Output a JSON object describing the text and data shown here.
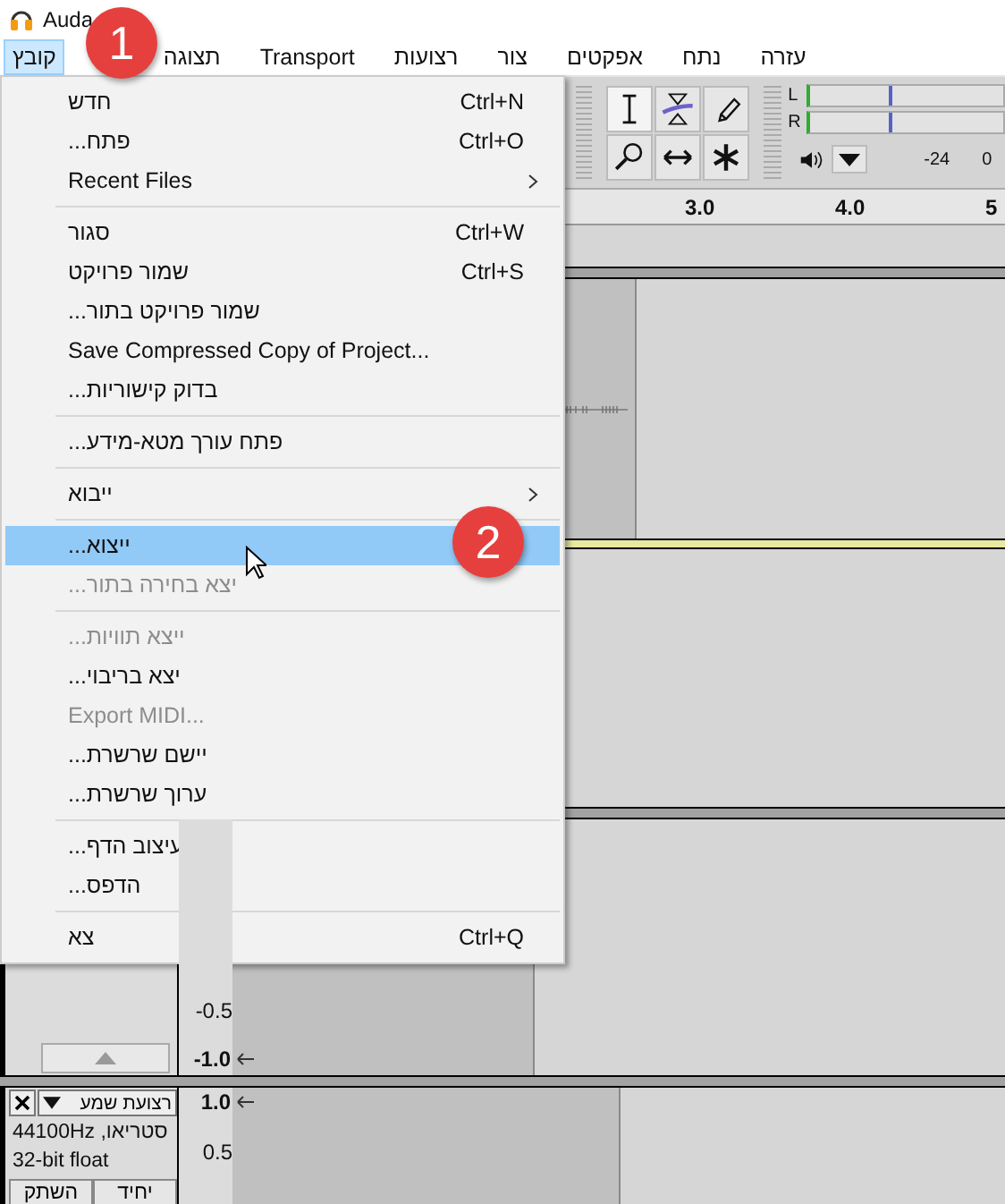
{
  "window": {
    "title": "Auda"
  },
  "menubar": [
    {
      "label": "עזרה",
      "selected": false
    },
    {
      "label": "נתח",
      "selected": false
    },
    {
      "label": "אפקטים",
      "selected": false
    },
    {
      "label": "צור",
      "selected": false
    },
    {
      "label": "רצועות",
      "selected": false
    },
    {
      "label": "Transport",
      "selected": false
    },
    {
      "label": "תצוגה",
      "selected": false
    },
    {
      "label": "קובץ",
      "selected": true
    }
  ],
  "file_menu": [
    {
      "kind": "item",
      "label": "חדש",
      "shortcut": "Ctrl+N",
      "submenu": false,
      "disabled": false,
      "selected": false
    },
    {
      "kind": "item",
      "label": "פתח...",
      "shortcut": "Ctrl+O",
      "submenu": false,
      "disabled": false,
      "selected": false
    },
    {
      "kind": "item",
      "label": "Recent Files",
      "submenu": true,
      "disabled": false,
      "selected": false
    },
    {
      "kind": "separator"
    },
    {
      "kind": "item",
      "label": "סגור",
      "shortcut": "Ctrl+W",
      "submenu": false,
      "disabled": false,
      "selected": false
    },
    {
      "kind": "item",
      "label": "שמור פרויקט",
      "shortcut": "Ctrl+S",
      "submenu": false,
      "disabled": false,
      "selected": false
    },
    {
      "kind": "item",
      "label": "שמור פרויקט בתור...",
      "submenu": false,
      "disabled": false,
      "selected": false
    },
    {
      "kind": "item",
      "label": "Save Compressed Copy of Project...",
      "submenu": false,
      "disabled": false,
      "selected": false
    },
    {
      "kind": "item",
      "label": "בדוק קישוריות...",
      "submenu": false,
      "disabled": false,
      "selected": false
    },
    {
      "kind": "separator"
    },
    {
      "kind": "item",
      "label": "פתח עורך מטא-מידע...",
      "submenu": false,
      "disabled": false,
      "selected": false
    },
    {
      "kind": "separator"
    },
    {
      "kind": "item",
      "label": "ייבוא",
      "submenu": true,
      "disabled": false,
      "selected": false
    },
    {
      "kind": "separator"
    },
    {
      "kind": "item",
      "label": "ייצוא...",
      "submenu": false,
      "disabled": false,
      "selected": true
    },
    {
      "kind": "item",
      "label": "יצא בחירה בתור...",
      "submenu": false,
      "disabled": true,
      "selected": false
    },
    {
      "kind": "separator"
    },
    {
      "kind": "item",
      "label": "ייצא תוויות...",
      "submenu": false,
      "disabled": true,
      "selected": false
    },
    {
      "kind": "item",
      "label": "יצא בריבוי...",
      "submenu": false,
      "disabled": false,
      "selected": false
    },
    {
      "kind": "item",
      "label": "Export MIDI...",
      "submenu": false,
      "disabled": true,
      "selected": false
    },
    {
      "kind": "item",
      "label": "יישם שרשרת...",
      "submenu": false,
      "disabled": false,
      "selected": false
    },
    {
      "kind": "item",
      "label": "ערוך שרשרת...",
      "submenu": false,
      "disabled": false,
      "selected": false
    },
    {
      "kind": "separator"
    },
    {
      "kind": "item",
      "label": "עיצוב הדף...",
      "submenu": false,
      "disabled": false,
      "selected": false
    },
    {
      "kind": "item",
      "label": "הדפס...",
      "submenu": false,
      "disabled": false,
      "selected": false
    },
    {
      "kind": "separator"
    },
    {
      "kind": "item",
      "label": "צא",
      "shortcut": "Ctrl+Q",
      "submenu": false,
      "disabled": false,
      "selected": false
    }
  ],
  "badges": [
    "1",
    "2"
  ],
  "meter": {
    "channels": [
      "L",
      "R"
    ],
    "scale": [
      "0",
      "-24"
    ]
  },
  "ruler": [
    "5",
    "4.0",
    "3.0"
  ],
  "tracks": [
    {
      "scale": [
        "-0.5",
        "-1.0"
      ]
    },
    {
      "name": "רצועת שמע",
      "info": [
        "סטריאו, 44100Hz",
        "32-bit float"
      ],
      "buttons": [
        "יחיד",
        "השתק"
      ],
      "scale": [
        "1.0",
        "0.5"
      ]
    }
  ]
}
